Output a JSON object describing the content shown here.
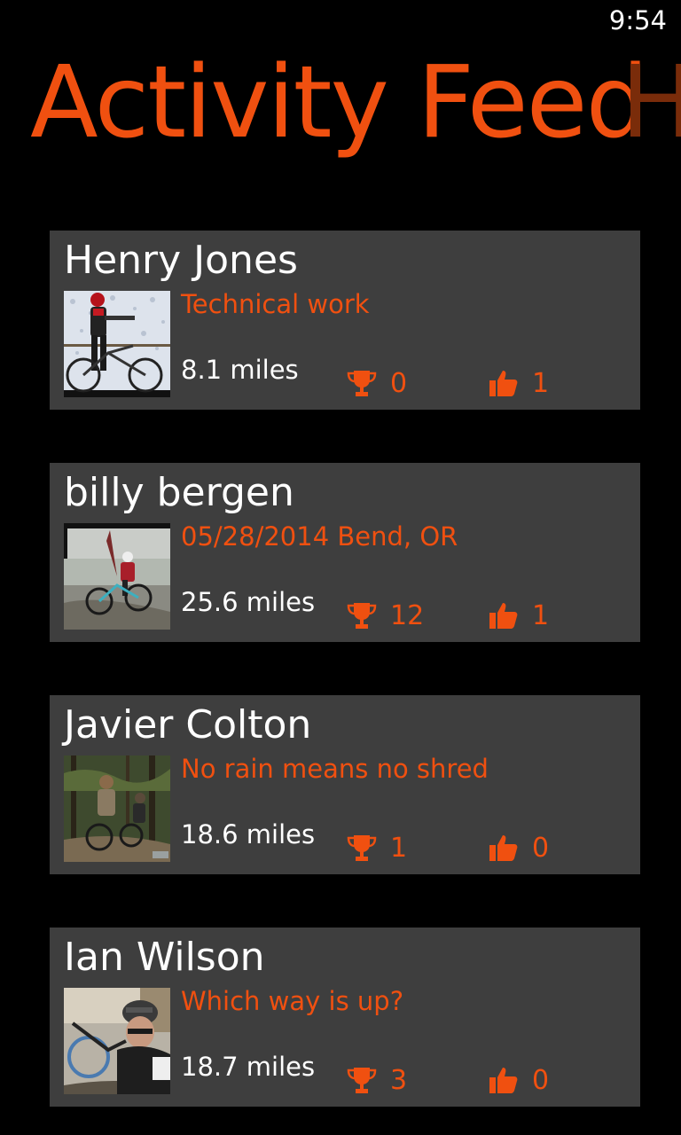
{
  "status_bar": {
    "time": "9:54"
  },
  "header": {
    "title": "Activity Feed",
    "next_title_peek": "H"
  },
  "colors": {
    "accent": "#f05010",
    "card_bg": "#3e3e3e",
    "background": "#000000",
    "title_peek": "#7a2c0a"
  },
  "feed": [
    {
      "name": "Henry Jones",
      "activity_title": "Technical work",
      "distance": "8.1 miles",
      "trophies": "0",
      "likes": "1",
      "photo": "cyclist-in-snow-photo"
    },
    {
      "name": "billy  bergen",
      "activity_title": "05/28/2014 Bend, OR",
      "distance": "25.6 miles",
      "trophies": "12",
      "likes": "1",
      "photo": "mountain-biker-race-photo"
    },
    {
      "name": "Javier Colton",
      "activity_title": "No rain means no shred",
      "distance": "18.6 miles",
      "trophies": "1",
      "likes": "0",
      "photo": "riders-in-forest-photo"
    },
    {
      "name": "Ian Wilson",
      "activity_title": "Which way is up?",
      "distance": "18.7 miles",
      "trophies": "3",
      "likes": "0",
      "photo": "rider-with-helmet-photo"
    }
  ],
  "icons": {
    "trophy": "trophy-icon",
    "like": "thumbs-up-icon"
  }
}
